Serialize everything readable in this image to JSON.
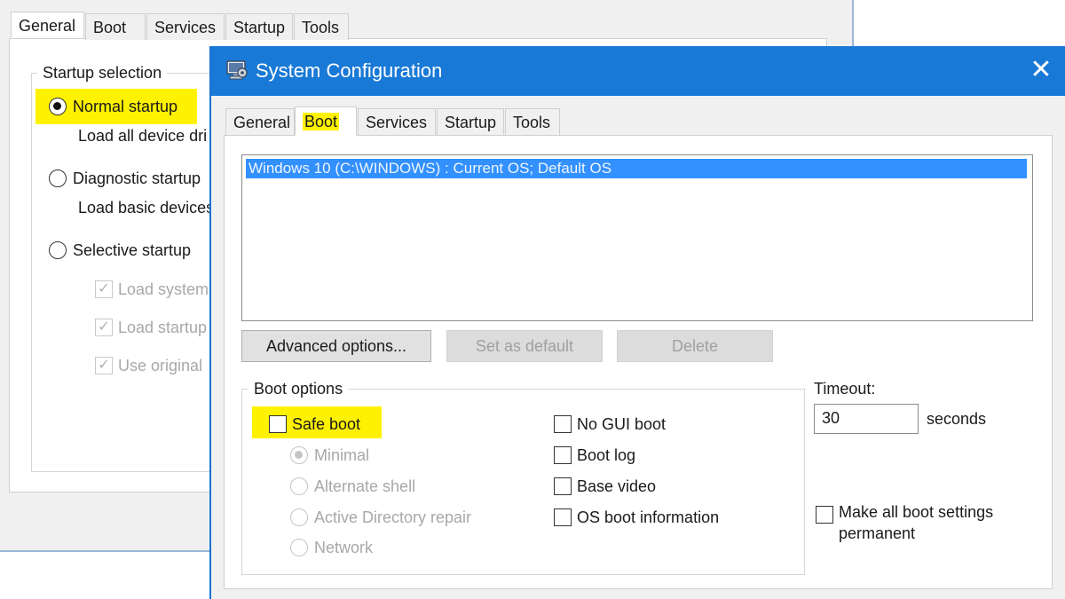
{
  "back_window": {
    "tabs": [
      "General",
      "Boot",
      "Services",
      "Startup",
      "Tools"
    ],
    "group_title": "Startup selection",
    "normal_startup": "Normal startup",
    "normal_desc": "Load all device dri",
    "diagnostic_startup": "Diagnostic startup",
    "diagnostic_desc": "Load basic devices",
    "selective_startup": "Selective startup",
    "load_system": "Load system",
    "load_startup": "Load startup",
    "use_original": "Use original"
  },
  "front_window": {
    "title": "System Configuration",
    "tabs": [
      "General",
      "Boot",
      "Services",
      "Startup",
      "Tools"
    ],
    "os_entry": "Windows 10 (C:\\WINDOWS) : Current OS; Default OS",
    "advanced_options": "Advanced options...",
    "set_as_default": "Set as default",
    "delete": "Delete",
    "boot_options_title": "Boot options",
    "safe_boot": "Safe boot",
    "minimal": "Minimal",
    "alternate_shell": "Alternate shell",
    "ad_repair": "Active Directory repair",
    "network": "Network",
    "no_gui_boot": "No GUI boot",
    "boot_log": "Boot log",
    "base_video": "Base video",
    "os_boot_info": "OS boot information",
    "timeout_label": "Timeout:",
    "timeout_value": "30",
    "seconds": "seconds",
    "make_permanent_1": "Make all boot settings",
    "make_permanent_2": "permanent"
  },
  "colors": {
    "titlebar": "#1979d6",
    "highlight": "#fff200",
    "selection": "#3390ff"
  }
}
